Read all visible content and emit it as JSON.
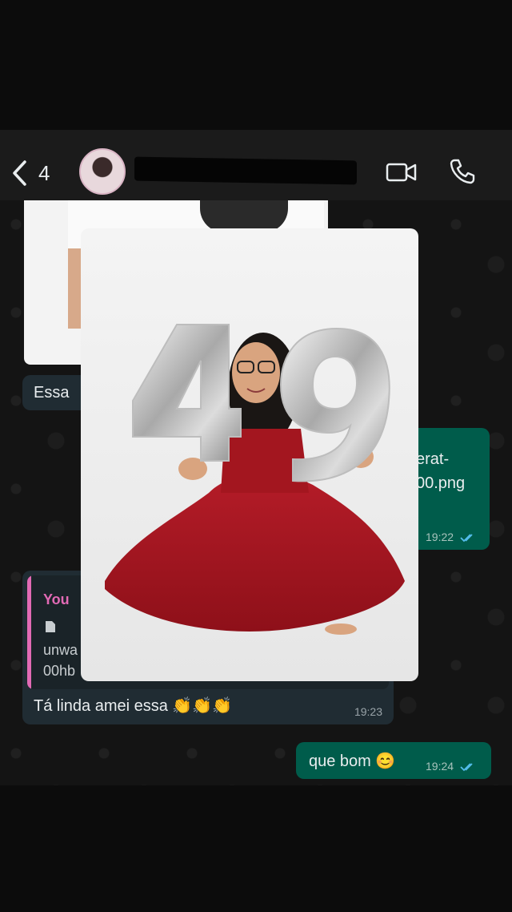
{
  "header": {
    "unread_count": "4"
  },
  "messages": {
    "essa": "Essa",
    "file_name_line1": "erat-",
    "file_name_line2": "00.png",
    "file_time": "19:22",
    "quote_author": "You",
    "quote_name_line1": "unwa",
    "quote_name_line2": "00hb",
    "reply_text": "Tá linda amei essa 👏👏👏",
    "reply_time": "19:23",
    "bom_text": "que bom 😊",
    "bom_time": "19:24"
  },
  "photo": {
    "balloon_number": "49"
  },
  "colors": {
    "incoming_bubble": "#202c33",
    "outgoing_bubble": "#005c4b",
    "quote_accent": "#e26ab5",
    "read_ticks": "#53bdeb",
    "dress": "#a3161f"
  }
}
